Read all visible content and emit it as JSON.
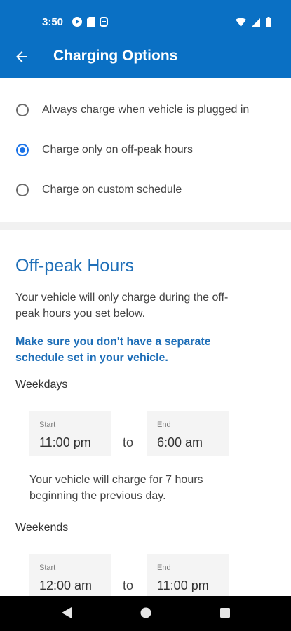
{
  "status_bar": {
    "time": "3:50",
    "left_icons": [
      "play-icon",
      "sd-card-icon",
      "sync-icon"
    ],
    "right_icons": [
      "wifi-icon",
      "signal-icon",
      "battery-icon"
    ]
  },
  "app_bar": {
    "title": "Charging Options",
    "back_icon": "arrow-left-icon",
    "color": "#0a70c4"
  },
  "charging_options": [
    {
      "label": "Always charge when vehicle is plugged in",
      "selected": false
    },
    {
      "label": "Charge only on off-peak hours",
      "selected": true
    },
    {
      "label": "Charge on custom schedule",
      "selected": false
    }
  ],
  "off_peak": {
    "heading": "Off-peak Hours",
    "description": "Your vehicle will only charge during the off-peak hours you set below.",
    "warning": "Make sure you don't have a separate schedule set in your vehicle.",
    "weekdays": {
      "label": "Weekdays",
      "start_label": "Start",
      "start_value": "11:00 pm",
      "to": "to",
      "end_label": "End",
      "end_value": "6:00 am",
      "note": "Your vehicle will charge for 7 hours beginning the previous day."
    },
    "weekends": {
      "label": "Weekends",
      "start_label": "Start",
      "start_value": "12:00 am",
      "to": "to",
      "end_label": "End",
      "end_value": "11:00 pm"
    }
  },
  "nav_bar": {
    "buttons": [
      "back-triangle-icon",
      "home-circle-icon",
      "recents-square-icon"
    ]
  },
  "colors": {
    "accent": "#1f6fb8",
    "radio_selected": "#1a73e8"
  }
}
